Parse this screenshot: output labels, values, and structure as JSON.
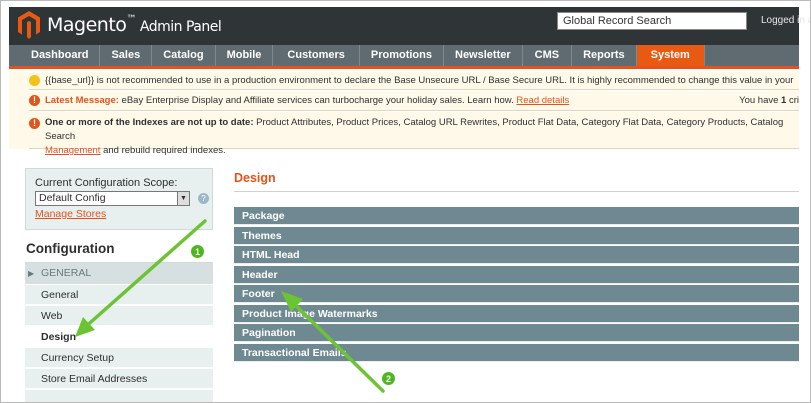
{
  "header": {
    "brand": "Magento",
    "subtitle": "Admin Panel",
    "search_value": "Global Record Search",
    "logged_in": "Logged in a"
  },
  "nav": {
    "items": [
      {
        "label": "Dashboard"
      },
      {
        "label": "Sales"
      },
      {
        "label": "Catalog"
      },
      {
        "label": "Mobile"
      },
      {
        "label": "Customers"
      },
      {
        "label": "Promotions"
      },
      {
        "label": "Newsletter"
      },
      {
        "label": "CMS"
      },
      {
        "label": "Reports"
      },
      {
        "label": "System"
      }
    ],
    "active": "System"
  },
  "notices": {
    "base_url": "{{base_url}} is not recommended to use in a production environment to declare the Base Unsecure URL / Base Secure URL. It is highly recommended to change this value in your Magent",
    "latest_label": "Latest Message:",
    "latest_text": " eBay Enterprise Display and Affiliate services can turbocharge your holiday sales. Learn how. ",
    "read_details": "Read details",
    "you_have": "You have ",
    "you_have_count": "1",
    "you_have_tail": " cri",
    "index_label": "One or more of the Indexes are not up to date:",
    "index_text": " Product Attributes, Product Prices, Catalog URL Rewrites, Product Flat Data, Category Flat Data, Category Products, Catalog Search",
    "index_link": "Management",
    "index_tail": " and rebuild required indexes."
  },
  "scope": {
    "label": "Current Configuration Scope:",
    "selected": "Default Config",
    "manage_stores": "Manage Stores"
  },
  "sidebar": {
    "title": "Configuration",
    "group": "GENERAL",
    "items": [
      {
        "label": "General"
      },
      {
        "label": "Web"
      },
      {
        "label": "Design"
      },
      {
        "label": "Currency Setup"
      },
      {
        "label": "Store Email Addresses"
      }
    ],
    "active": "Design"
  },
  "main": {
    "title": "Design",
    "sections": [
      {
        "label": "Package"
      },
      {
        "label": "Themes"
      },
      {
        "label": "HTML Head"
      },
      {
        "label": "Header"
      },
      {
        "label": "Footer"
      },
      {
        "label": "Product Image Watermarks"
      },
      {
        "label": "Pagination"
      },
      {
        "label": "Transactional Emails"
      }
    ]
  },
  "annotations": {
    "step_1": "1",
    "step_2": "2",
    "arrow_color": "#6cc334"
  },
  "colors": {
    "accent": "#e2541a",
    "nav_bg": "#5f6b71",
    "section_bar": "#6f8992",
    "header_bg": "#2f3437"
  }
}
